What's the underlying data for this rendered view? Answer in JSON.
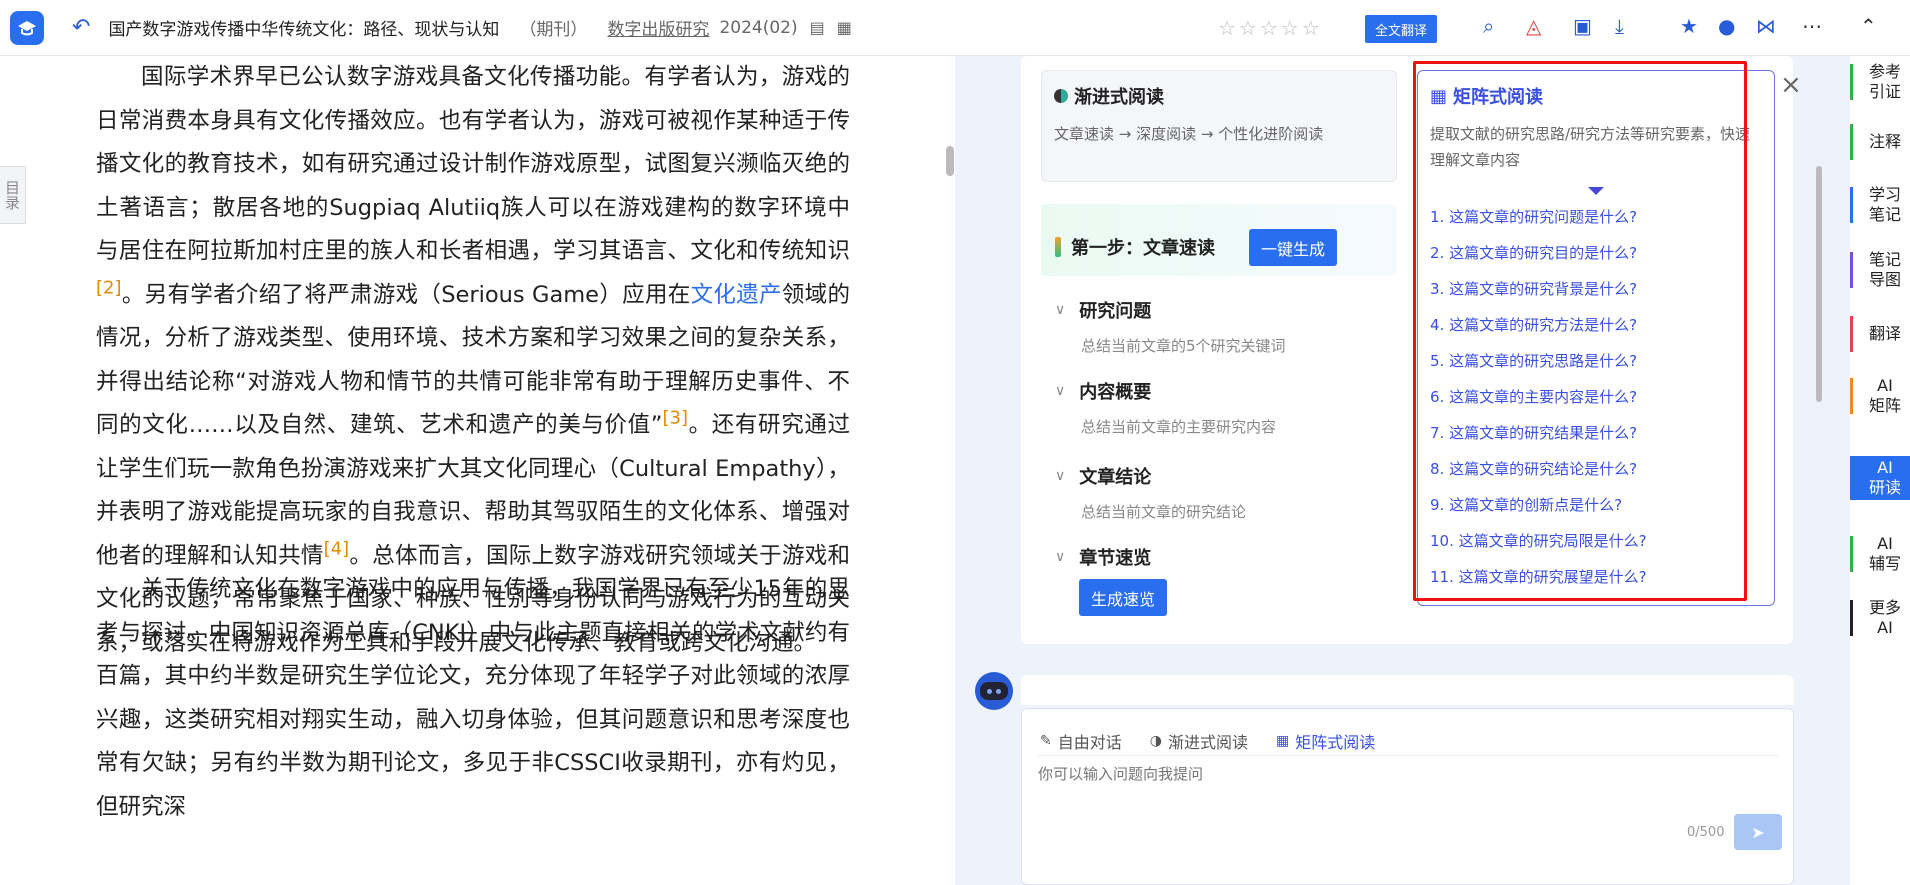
{
  "header": {
    "title": "国产数字游戏传播中华传统文化：路径、现状与认知",
    "type": "（期刊）",
    "journal": "数字出版研究",
    "issue": "2024(02)",
    "translate_label": "全文翻译",
    "stars": "☆☆☆☆☆"
  },
  "article": {
    "toc_label": "目录",
    "p1_a": "国际学术界早已公认数字游戏具备文化传播功能。有学者认为，游戏的日常消费本身具有文化传播效应。也有学者认为，游戏可被视作某种适于传播文化的教育技术，如有研究通过设计制作游戏原型，试图复兴濒临灭绝的土著语言；散居各地的Sugpiaq Alutiiq族人可以在游戏建构的数字环境中与居住在阿拉斯加村庄里的族人和长者相遇，学习其语言、文化和传统知识",
    "ref2": "[2]",
    "p1_b": "。另有学者介绍了将严肃游戏（Serious Game）应用在",
    "kw1": "文化遗产",
    "p1_c": "领域的情况，分析了游戏类型、使用环境、技术方案和学习效果之间的复杂关系，并得出结论称“对游戏人物和情节的共情可能非常有助于理解历史事件、不同的文化……以及自然、建筑、艺术和遗产的美与价值”",
    "ref3": "[3]",
    "p1_d": "。还有研究通过让学生们玩一款角色扮演游戏来扩大其文化同理心（Cultural Empathy），并表明了游戏能提高玩家的自我意识、帮助其驾驭陌生的文化体系、增强对他者的理解和认知共情",
    "ref4": "[4]",
    "p1_e": "。总体而言，国际上数字游戏研究领域关于游戏和文化的议题，常常聚焦于国家、种族、性别等身份认同与游戏行为的互动关系，或落实在将游戏作为工具和手段开展文化传承、教育或跨文化沟通。",
    "p2": "关于传统文化在数字游戏中的应用与传播，我国学界已有至少15年的思考与探讨。中国知识资源总库（CNKI）中与此主题直接相关的学术文献约有百篇，其中约半数是研究生学位论文，充分体现了年轻学子对此领域的浓厚兴趣，这类研究相对翔实生动，融入切身体验，但其问题意识和思考深度也常有欠缺；另有约半数为期刊论文，多见于非CSSCI收录期刊，亦有灼见，但研究深"
  },
  "progressive": {
    "title": "渐进式阅读",
    "desc": "文章速读 → 深度阅读 → 个性化进阶阅读"
  },
  "matrix": {
    "title": "矩阵式阅读",
    "desc": "提取文献的研究思路/研究方法等研究要素，快速理解文章内容",
    "questions": [
      "1. 这篇文章的研究问题是什么?",
      "2. 这篇文章的研究目的是什么?",
      "3. 这篇文章的研究背景是什么?",
      "4. 这篇文章的研究方法是什么?",
      "5. 这篇文章的研究思路是什么?",
      "6. 这篇文章的主要内容是什么?",
      "7. 这篇文章的研究结果是什么?",
      "8. 这篇文章的研究结论是什么?",
      "9. 这篇文章的创新点是什么?",
      "10. 这篇文章的研究局限是什么?",
      "11. 这篇文章的研究展望是什么?"
    ]
  },
  "step": {
    "title": "第一步：文章速读",
    "button": "一键生成"
  },
  "sections": [
    {
      "title": "研究问题",
      "desc": "总结当前文章的5个研究关键词"
    },
    {
      "title": "内容概要",
      "desc": "总结当前文章的主要研究内容"
    },
    {
      "title": "文章结论",
      "desc": "总结当前文章的研究结论"
    },
    {
      "title": "章节速览",
      "desc": ""
    }
  ],
  "speed_button": "生成速览",
  "chat": {
    "tabs": [
      "自由对话",
      "渐进式阅读",
      "矩阵式阅读"
    ],
    "placeholder": "你可以输入问题向我提问",
    "count": "0/500"
  },
  "sidebar": {
    "items": [
      {
        "label": "参考\n引证",
        "color": "#2cb34a"
      },
      {
        "label": "注释",
        "color": "#2cb34a"
      },
      {
        "label": "学习\n笔记",
        "color": "#2a6ef0"
      },
      {
        "label": "笔记\n导图",
        "color": "#7a4fe0"
      },
      {
        "label": "翻译",
        "color": "#e04646"
      },
      {
        "label": "AI\n矩阵",
        "color": "#f08a1e"
      },
      {
        "label": "AI\n研读",
        "color": "#2a6ef0"
      },
      {
        "label": "AI\n辅写",
        "color": "#2cb34a"
      },
      {
        "label": "更多\nAI",
        "color": "#222222"
      }
    ]
  },
  "colors": {
    "accent": "#2a6ef0",
    "matrix": "#3a4fe0",
    "highlight": "#e11111"
  }
}
